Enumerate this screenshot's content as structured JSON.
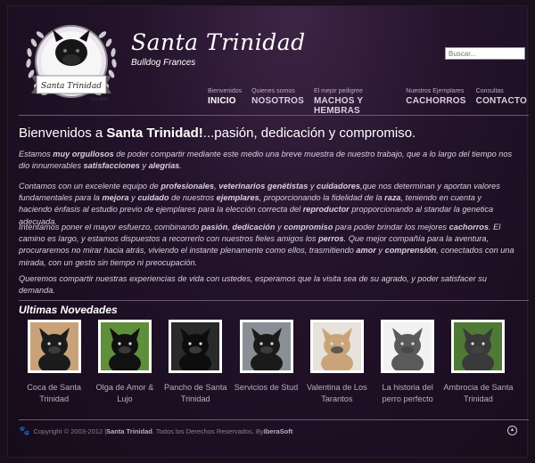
{
  "header": {
    "title": "Santa Trinidad",
    "subtitle": "Bulldog Frances",
    "logo_text": "Santa Trinidad",
    "logo_est": "FCA 2003",
    "search_placeholder": "Buscar..."
  },
  "nav": [
    {
      "small": "Bienvenidos",
      "label": "INICIO",
      "active": true
    },
    {
      "small": "Quienes somos",
      "label": "NOSOTROS",
      "active": false
    },
    {
      "small": "El mejor pedigree",
      "label": "MACHOS Y HEMBRAS",
      "active": false
    },
    {
      "small": "Nuestros Ejemplares",
      "label": "CACHORROS",
      "active": false
    },
    {
      "small": "Consultas",
      "label": "CONTACTO",
      "active": false
    }
  ],
  "welcome": {
    "prefix": "Bienvenidos a ",
    "brand": "Santa Trinidad!",
    "suffix": "...pasión, dedicación y compromiso."
  },
  "paragraphs": [
    "Estamos <b>muy orgullosos</b> de poder compartir mediante este medio una breve muestra de nuestro trabajo, que a lo largo del tiempo nos dio innumerables <b>satisfacciones</b> y <b>alegrías</b>.",
    "Contamos con un excelente equipo de <b>profesionales</b>, <b>veterinarios genétistas</b> y <b>cuidadores</b>,que nos determinan y aportan valores fundamentales para la <b>mejora</b> y <b>cuidado</b> de nuestros <b>ejemplares</b>, proporcionando la fidelidad de la <b>raza</b>, teniendo en cuenta y haciendo énfasis al estudio previo de ejemplares para la elección correcta del <b>reproductor</b> propporcionando al standar la genetica adecuada.",
    "Intentamos poner el mayor esfuerzo, combinando <b>pasión</b>, <b>dedicación</b> y <b>compromiso</b> para poder brindar los mejores <b>cachorros</b>. El camino es largo, y estamos dispuestos a recorrerlo con nuestros fieles amigos los <b>perros</b>. Que mejor compañía para la aventura, procuraremos no mirar hacia atrás, viviendo el instante plenamente como ellos, trasmitiendo <b>amor</b> y <b>comprensión</b>, conectados con una mirada, con un gesto sin tiempo ni preocupación.",
    "Queremos compartir nuestras experiencias de vida con ustedes, esperamos que la visita sea de su agrado, y poder satisfacer su demanda."
  ],
  "novedades": {
    "title": "Ultimas Novedades",
    "items": [
      {
        "caption": "Coca de Santa Trinidad",
        "bg": "#c9a27a",
        "dog": "#1c1c1c"
      },
      {
        "caption": "Olga de Amor & Lujo",
        "bg": "#5f8f3a",
        "dog": "#111111"
      },
      {
        "caption": "Pancho de Santa Trinidad",
        "bg": "#2a2a2a",
        "dog": "#0d0d0d"
      },
      {
        "caption": "Servicios de Stud",
        "bg": "#8a8f96",
        "dog": "#1a1a1a"
      },
      {
        "caption": "Valentina de Los Tarantos",
        "bg": "#e8e2dc",
        "dog": "#c8a478"
      },
      {
        "caption": "La historia del perro perfecto",
        "bg": "#f2f2f2",
        "dog": "#5a5a5a"
      },
      {
        "caption": "Ambrocia de Santa Trinidad",
        "bg": "#4e7a35",
        "dog": "#3a3a3a"
      }
    ]
  },
  "footer": {
    "copy": "Copyright © 2003-2012 | ",
    "brand": "Santa Trinidad",
    "rights": " . Todos los Derechos Reservados. By ",
    "by": "IberaSoft"
  },
  "icons": {
    "paw": "paw-icon",
    "top": "arrow-up-icon"
  }
}
